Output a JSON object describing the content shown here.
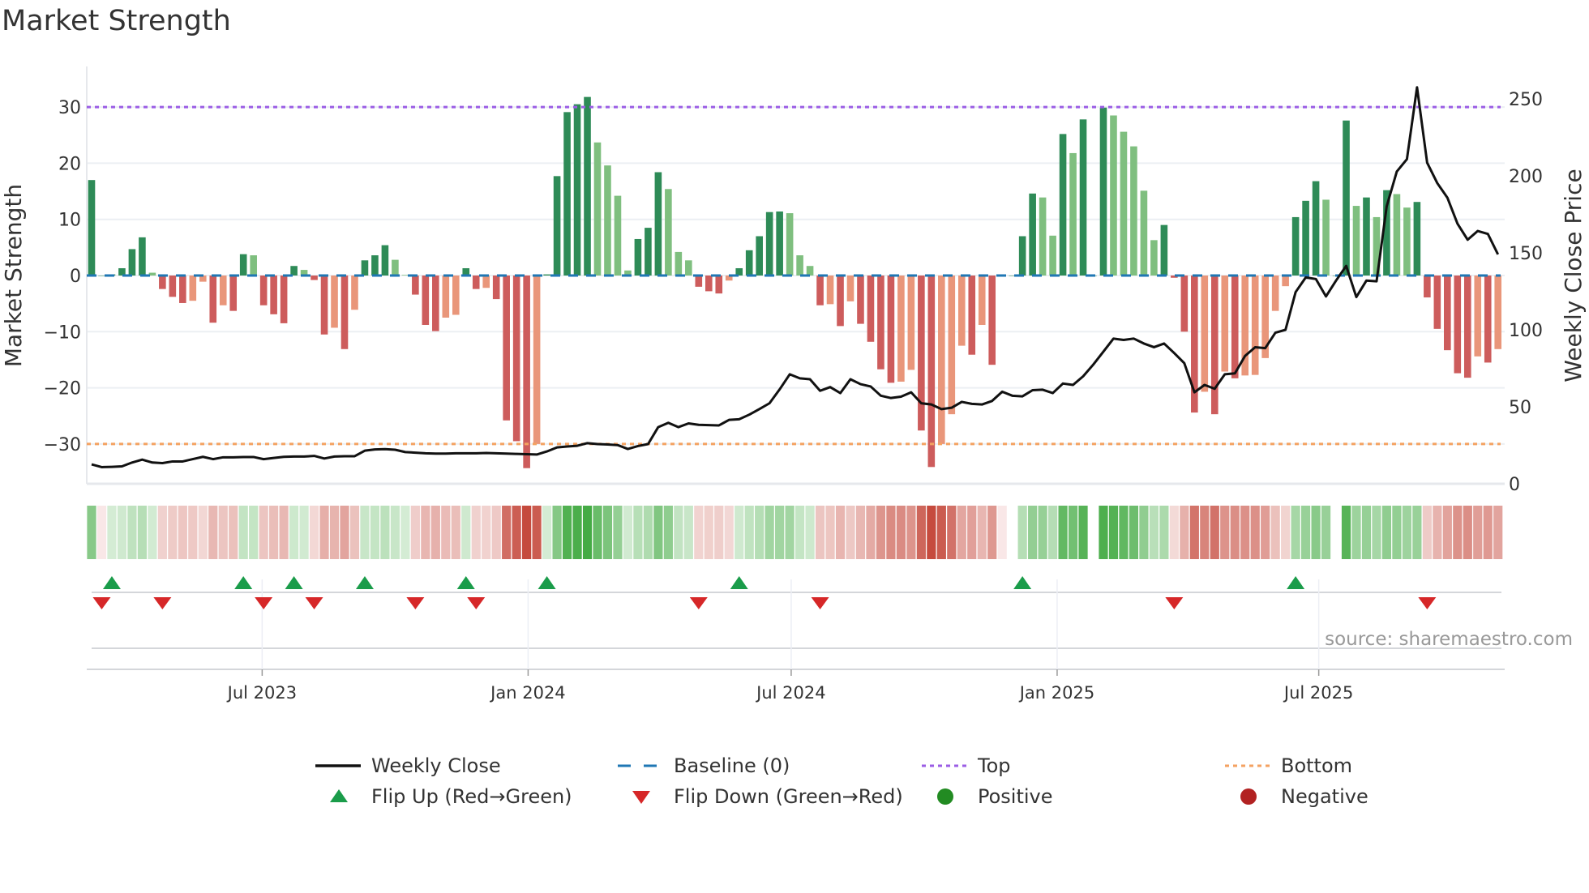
{
  "title": "Market Strength",
  "source": "source: sharemaestro.com",
  "chart_data": {
    "type": "bar",
    "title": "Market Strength",
    "start_date": "2023-03-05",
    "frequency": "weekly",
    "ylabel": "Market Strength",
    "ylabel_right": "Weekly Close Price",
    "ylim": [
      -37,
      37
    ],
    "ylim_right": [
      0,
      270
    ],
    "yticks": [
      30,
      20,
      10,
      0,
      -10,
      -20,
      -30
    ],
    "ytick_labels": [
      "30",
      "20",
      "10",
      "0",
      "−10",
      "−20",
      "−30"
    ],
    "yticks_right": [
      250,
      200,
      150,
      100,
      50,
      0
    ],
    "ytick_labels_right": [
      "250",
      "200",
      "150",
      "100",
      "50",
      "0"
    ],
    "xticks": [
      {
        "date": "2023-07-01",
        "label": "Jul 2023"
      },
      {
        "date": "2024-01-01",
        "label": "Jan 2024"
      },
      {
        "date": "2024-07-01",
        "label": "Jul 2024"
      },
      {
        "date": "2025-01-01",
        "label": "Jan 2025"
      },
      {
        "date": "2025-07-01",
        "label": "Jul 2025"
      }
    ],
    "top_level": 30,
    "bottom_level": -30,
    "baseline": 0,
    "strength": [
      17,
      0,
      0.2,
      1.3,
      4.7,
      6.8,
      0.5,
      -2.4,
      -3.8,
      -4.9,
      -4.5,
      -1.1,
      -8.4,
      -5.3,
      -6.3,
      3.8,
      3.6,
      -5.3,
      -6.9,
      -8.5,
      1.7,
      1.0,
      -0.8,
      -10.5,
      -9.3,
      -13.1,
      -6.1,
      2.7,
      3.6,
      5.4,
      2.8,
      0.1,
      -3.4,
      -8.8,
      -9.9,
      -7.5,
      -7.0,
      1.3,
      -2.4,
      -2.2,
      -4.2,
      -25.8,
      -29.5,
      -34.3,
      -30,
      0.2,
      17.7,
      29.1,
      30.5,
      31.8,
      23.7,
      19.6,
      14.2,
      0.9,
      6.5,
      8.5,
      18.4,
      15.4,
      4.2,
      2.7,
      -2.0,
      -2.8,
      -3.2,
      -0.9,
      1.3,
      4.5,
      7.0,
      11.3,
      11.4,
      11.1,
      3.6,
      1.7,
      -5.3,
      -5.1,
      -9.0,
      -4.6,
      -8.6,
      -11.8,
      -16.7,
      -19.1,
      -18.9,
      -16.8,
      -27.6,
      -34.1,
      -30,
      -24.7,
      -12.5,
      -14.1,
      -8.8,
      -15.9,
      0,
      0,
      7.0,
      14.6,
      13.9,
      7.1,
      25.2,
      21.8,
      27.8,
      0,
      29.9,
      28.5,
      25.6,
      23.0,
      15.1,
      6.3,
      9.0,
      -0.4,
      -10,
      -24.4,
      -20.7,
      -24.7,
      -17.1,
      -18.3,
      -17.8,
      -17.7,
      -14.7,
      -6.3,
      -1.9,
      10.4,
      13.3,
      16.8,
      13.5,
      0,
      27.6,
      12.4,
      13.9,
      10.4,
      15.2,
      14.5,
      12.1,
      13.1,
      -3.9,
      -9.5,
      -13.3,
      -17.4,
      -18.2,
      -14.4,
      -15.5,
      -13.1
    ],
    "weekly_close": [
      12.6,
      10.8,
      11,
      11.3,
      13.8,
      15.7,
      13.8,
      13.4,
      14.5,
      14.5,
      16,
      17.5,
      16,
      17.2,
      17.2,
      17.4,
      17.4,
      16,
      16.8,
      17.5,
      17.7,
      17.7,
      18.1,
      16.4,
      17.7,
      17.9,
      17.9,
      21.5,
      22.3,
      22.5,
      22.1,
      20.6,
      20.2,
      19.8,
      19.6,
      19.6,
      19.8,
      19.8,
      19.8,
      20,
      19.8,
      19.6,
      19.4,
      19.2,
      19,
      21,
      23.6,
      24.2,
      24.7,
      26.4,
      25.8,
      25.5,
      25.1,
      22.6,
      24.5,
      25.8,
      36.8,
      39.6,
      36.8,
      39.2,
      38.3,
      38.1,
      37.9,
      41.5,
      41.9,
      44.9,
      48.5,
      52.3,
      61.3,
      71.1,
      68.5,
      67.9,
      60.4,
      62.8,
      58.9,
      67.9,
      64.7,
      63.2,
      57.2,
      55.7,
      56.6,
      59.4,
      52.3,
      51.5,
      48.5,
      49.4,
      53.2,
      51.9,
      51.5,
      53.8,
      59.8,
      57.2,
      56.8,
      60.8,
      61.1,
      58.9,
      65.1,
      64.2,
      69.8,
      77.4,
      85.8,
      94.3,
      93.4,
      94.3,
      91.1,
      88.7,
      91.1,
      84.9,
      78.3,
      59.4,
      64.2,
      61.7,
      71.1,
      71.7,
      83,
      88.7,
      88.1,
      98.1,
      100,
      124.5,
      134,
      133,
      121.7,
      132,
      141.5,
      121.3,
      132,
      131.5,
      180.2,
      202.8,
      210.8,
      257.5,
      208.5,
      195.3,
      185.8,
      168.9,
      158.5,
      164.2,
      162.3,
      149
    ],
    "flip_up_weeks": [
      2,
      15,
      20,
      27,
      37,
      45,
      64,
      92,
      119
    ],
    "flip_down_weeks": [
      1,
      7,
      17,
      22,
      32,
      38,
      60,
      72,
      107,
      132
    ],
    "legend": {
      "placement": "bottom",
      "items": [
        {
          "label": "Weekly Close",
          "kind": "line",
          "color": "#111111"
        },
        {
          "label": "Baseline (0)",
          "kind": "dash",
          "color": "#1f77b4"
        },
        {
          "label": "Top",
          "kind": "dot",
          "color": "#9b5de5"
        },
        {
          "label": "Bottom",
          "kind": "dot",
          "color": "#f4a261"
        },
        {
          "label": "Flip Up (Red→Green)",
          "kind": "tri-up",
          "color": "#1a9c4a"
        },
        {
          "label": "Flip Down (Green→Red)",
          "kind": "tri-down",
          "color": "#d62728"
        },
        {
          "label": "Positive",
          "kind": "circle",
          "color": "#228b22"
        },
        {
          "label": "Negative",
          "kind": "circle",
          "color": "#b22222"
        }
      ]
    },
    "colors": {
      "pos_strong": "#2e8b57",
      "pos_weak": "#7fbf7f",
      "neg_strong": "#cd5c5c",
      "neg_weak": "#e9967a",
      "strip_pos": "#2ca02c",
      "strip_neg": "#c0392b"
    }
  }
}
